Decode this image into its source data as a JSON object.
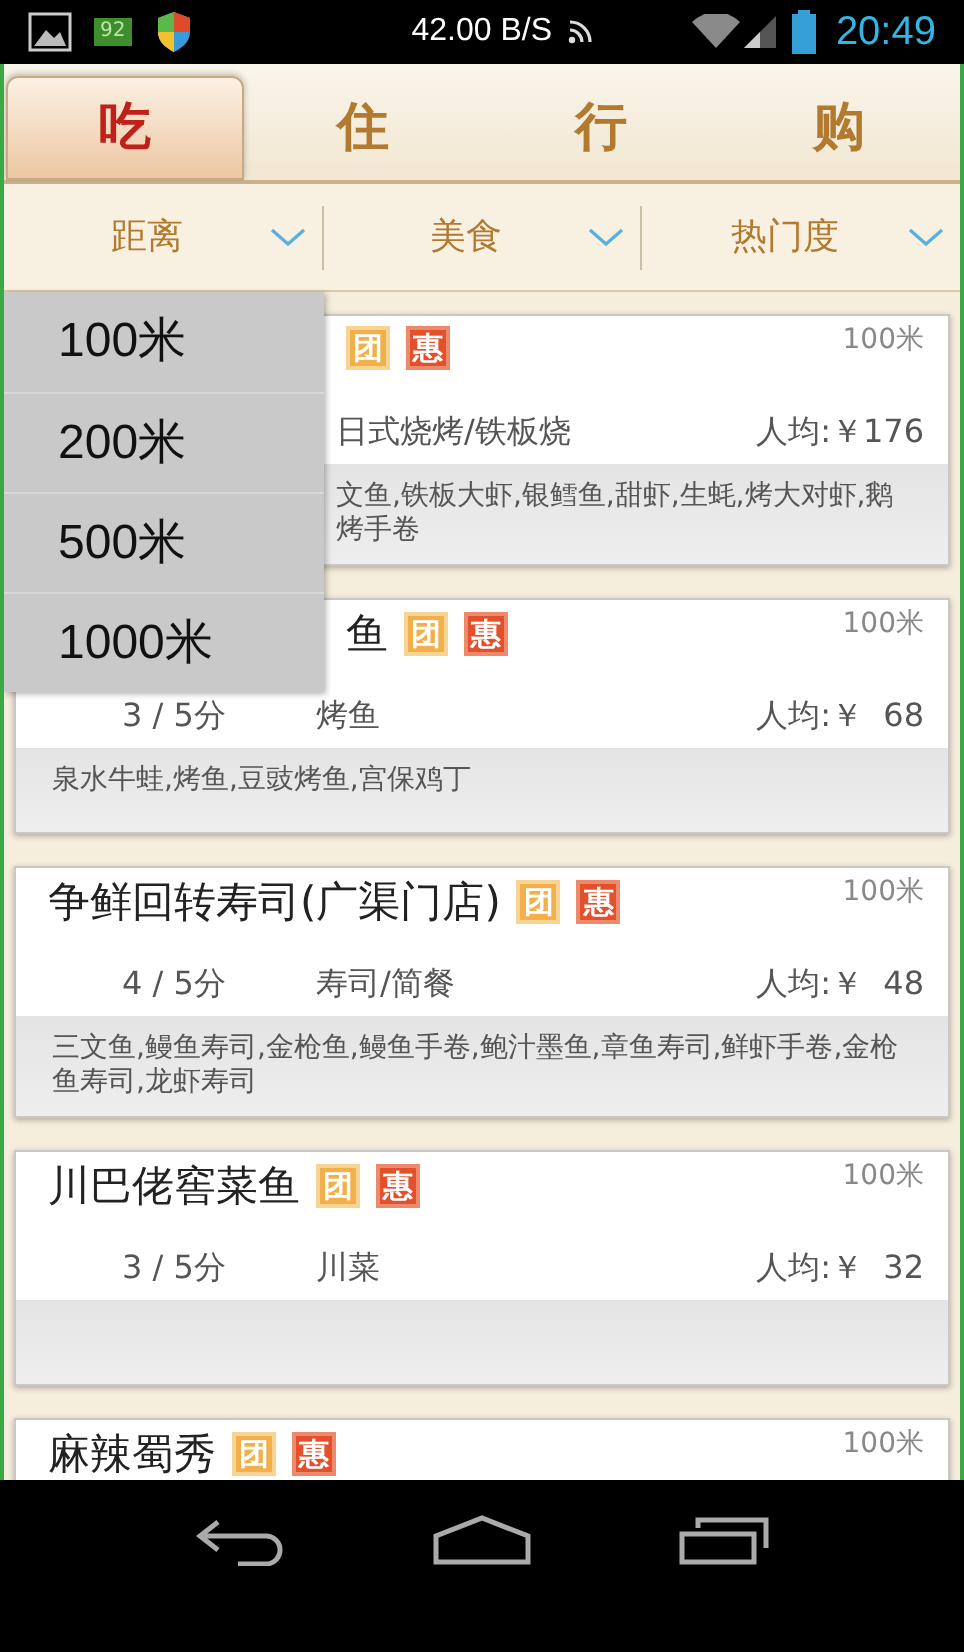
{
  "status_bar": {
    "speed": "42.00 B/S",
    "battery_badge": "92",
    "time": "20:49"
  },
  "tabs": [
    {
      "label": "吃",
      "selected": true
    },
    {
      "label": "住",
      "selected": false
    },
    {
      "label": "行",
      "selected": false
    },
    {
      "label": "购",
      "selected": false
    }
  ],
  "filters": [
    {
      "label": "距离"
    },
    {
      "label": "美食"
    },
    {
      "label": "热门度"
    }
  ],
  "dropdown": {
    "options": [
      "100米",
      "200米",
      "500米",
      "1000米"
    ]
  },
  "restaurants": [
    {
      "badges": [
        "团",
        "惠"
      ],
      "distance": "100米",
      "category": "日式烧烤/铁板烧",
      "price": "人均:￥176",
      "dishes": "文鱼,铁板大虾,银鳕鱼,甜虾,生蚝,烤大对虾,鹅烤手卷"
    },
    {
      "name": "鱼",
      "badges": [
        "团",
        "惠"
      ],
      "distance": "100米",
      "rating": "3 / 5分",
      "category": "烤鱼",
      "price": "人均:￥  68",
      "dishes": "泉水牛蛙,烤鱼,豆豉烤鱼,宫保鸡丁"
    },
    {
      "name": "争鲜回转寿司(广渠门店)",
      "badges": [
        "团",
        "惠"
      ],
      "distance": "100米",
      "rating": "4 / 5分",
      "category": "寿司/简餐",
      "price": "人均:￥  48",
      "dishes": "三文鱼,鳗鱼寿司,金枪鱼,鳗鱼手卷,鲍汁墨鱼,章鱼寿司,鲜虾手卷,金枪鱼寿司,龙虾寿司"
    },
    {
      "name": "川巴佬窖菜鱼",
      "badges": [
        "团",
        "惠"
      ],
      "distance": "100米",
      "rating": "3 / 5分",
      "category": "川菜",
      "price": "人均:￥  32"
    },
    {
      "name": "麻辣蜀秀",
      "badges": [
        "团",
        "惠"
      ],
      "distance": "100米"
    }
  ]
}
